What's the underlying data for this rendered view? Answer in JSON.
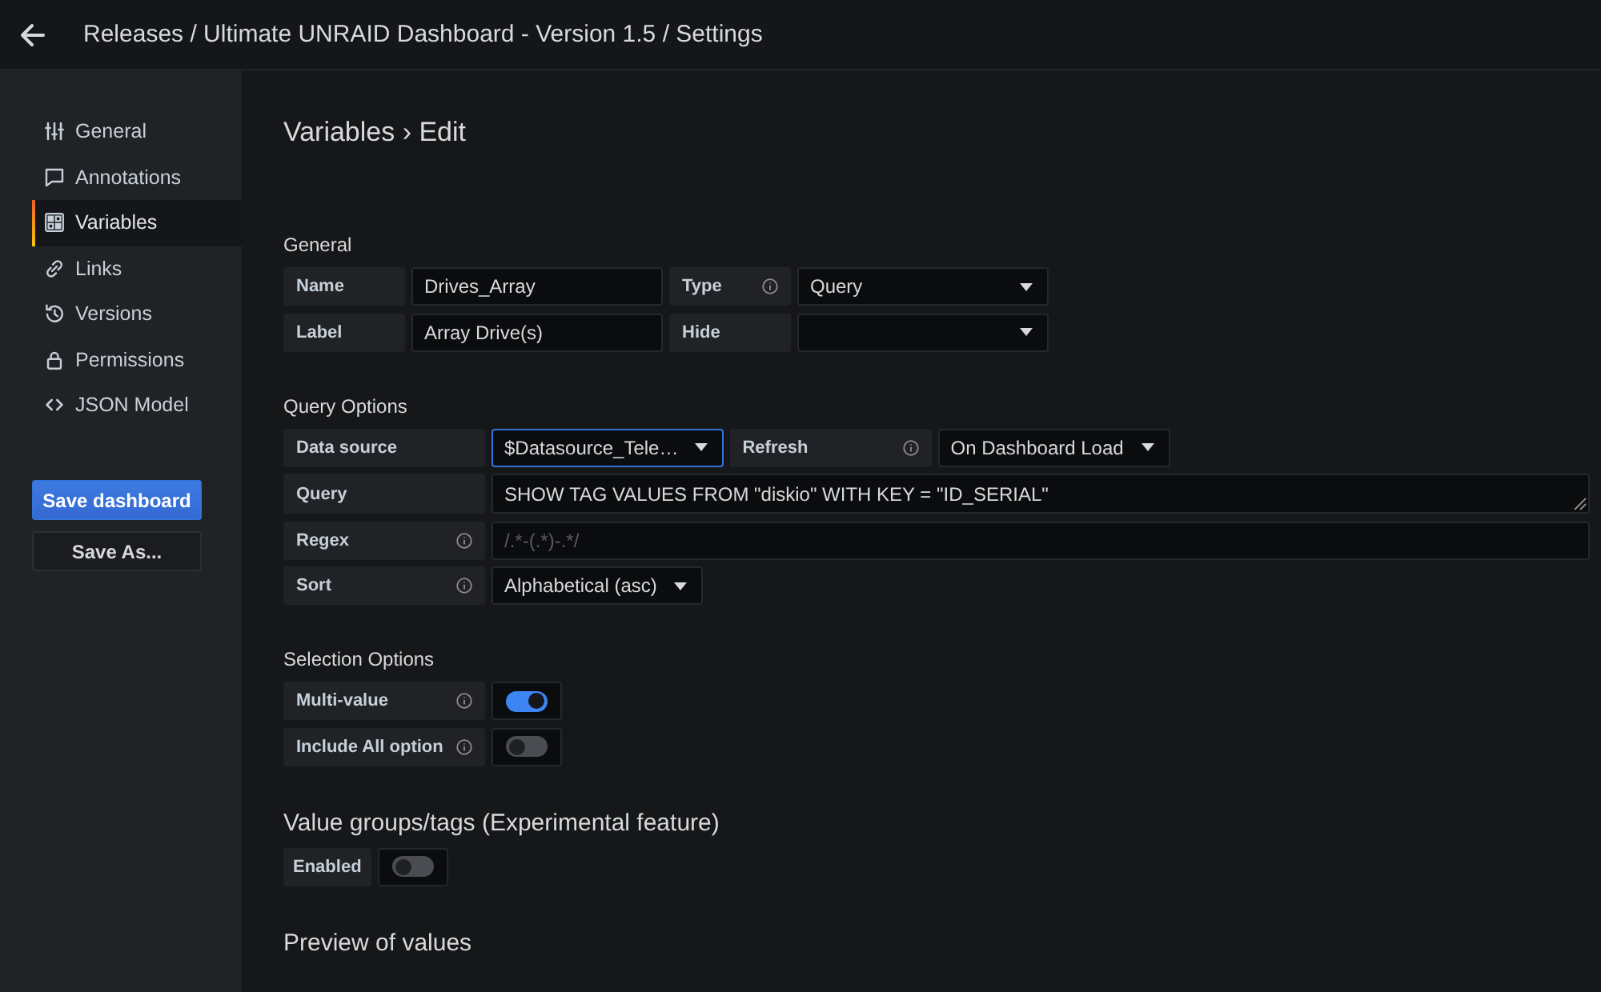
{
  "header": {
    "title": "Releases / Ultimate UNRAID Dashboard - Version 1.5 / Settings"
  },
  "sidebar": {
    "items": [
      {
        "label": "General",
        "selected": false
      },
      {
        "label": "Annotations",
        "selected": false
      },
      {
        "label": "Variables",
        "selected": true
      },
      {
        "label": "Links",
        "selected": false
      },
      {
        "label": "Versions",
        "selected": false
      },
      {
        "label": "Permissions",
        "selected": false
      },
      {
        "label": "JSON Model",
        "selected": false
      }
    ],
    "buttons": [
      {
        "label": "Save dashboard",
        "kind": "primary"
      },
      {
        "label": "Save As...",
        "kind": "secondary"
      }
    ]
  },
  "page_title": "Variables › Edit",
  "sections": [
    {
      "title": "General",
      "kind": "minor",
      "rows": [
        [
          {
            "label": "Name",
            "info": false,
            "kind": "input",
            "value": "Drives_Array",
            "focused": false
          },
          {
            "label": "Type",
            "info": true,
            "kind": "select",
            "value": "Query",
            "focused": false
          }
        ],
        [
          {
            "label": "Label",
            "info": false,
            "kind": "input",
            "value": "Array Drive(s)",
            "focused": false
          },
          {
            "label": "Hide",
            "info": false,
            "kind": "select",
            "focused": false
          }
        ]
      ]
    },
    {
      "title": "Query Options",
      "kind": "minor",
      "rows": [
        [
          {
            "label": "Data source",
            "info": false,
            "kind": "select",
            "value": "$Datasource_Tele…",
            "focused": true
          },
          {
            "label": "Refresh",
            "info": true,
            "kind": "select",
            "value": "On Dashboard Load",
            "focused": false
          }
        ],
        [
          {
            "label": "Query",
            "info": false,
            "kind": "textarea",
            "value": "SHOW TAG VALUES FROM \"diskio\" WITH KEY = \"ID_SERIAL\"",
            "focused": false
          }
        ],
        [
          {
            "label": "Regex",
            "info": true,
            "kind": "input",
            "placeholder": "/.*-(.*)-.*/",
            "focused": false
          }
        ],
        [
          {
            "label": "Sort",
            "info": true,
            "kind": "select",
            "value": "Alphabetical (asc)",
            "focused": false
          }
        ]
      ]
    },
    {
      "title": "Selection Options",
      "kind": "minor",
      "rows": [
        [
          {
            "label": "Multi-value",
            "info": true,
            "kind": "switch",
            "on": true
          }
        ],
        [
          {
            "label": "Include All option",
            "info": true,
            "kind": "switch",
            "on": false
          }
        ]
      ]
    },
    {
      "title": "Value groups/tags (Experimental feature)",
      "kind": "major",
      "rows": [
        [
          {
            "label": "Enabled",
            "info": false,
            "kind": "switch",
            "on": false
          }
        ]
      ]
    },
    {
      "title": "Preview of values",
      "kind": "major"
    }
  ]
}
